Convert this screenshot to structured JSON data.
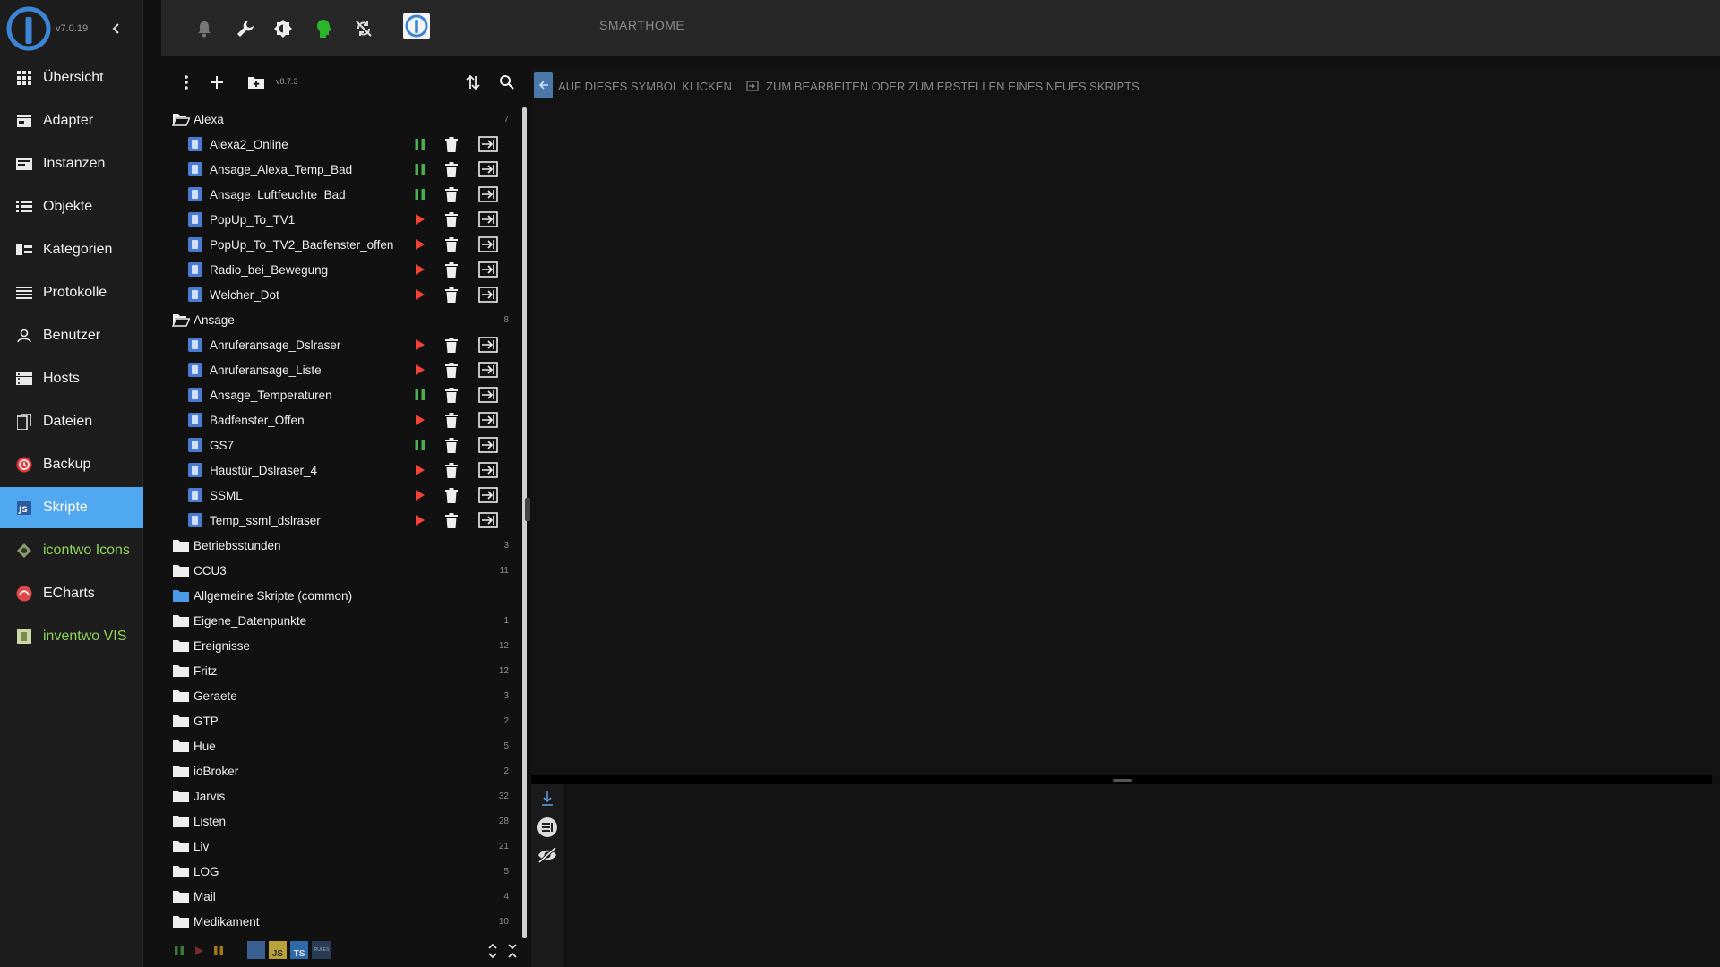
{
  "app": {
    "version": "v7.0.19",
    "brand": "SMARTHOME"
  },
  "colors": {
    "accent": "#50a8f0",
    "running": "#4caf50",
    "stopped": "#f44336",
    "instance_green": "#8fd35a"
  },
  "sidebar": {
    "items": [
      {
        "label": "Übersicht",
        "icon": "grid-icon"
      },
      {
        "label": "Adapter",
        "icon": "store-icon"
      },
      {
        "label": "Instanzen",
        "icon": "instances-icon"
      },
      {
        "label": "Objekte",
        "icon": "list-icon"
      },
      {
        "label": "Kategorien",
        "icon": "categories-icon"
      },
      {
        "label": "Protokolle",
        "icon": "lines-icon"
      },
      {
        "label": "Benutzer",
        "icon": "user-icon"
      },
      {
        "label": "Hosts",
        "icon": "hosts-icon"
      },
      {
        "label": "Dateien",
        "icon": "files-icon"
      },
      {
        "label": "Backup",
        "icon": "backup-icon"
      },
      {
        "label": "Skripte",
        "icon": "js-icon"
      },
      {
        "label": "icontwo Icons",
        "icon": "icontwo-icon"
      },
      {
        "label": "ECharts",
        "icon": "echarts-icon"
      },
      {
        "label": "inventwo VIS",
        "icon": "inventwo-icon"
      }
    ]
  },
  "tree": {
    "version": "v8.7.3",
    "groups": [
      {
        "name": "Alexa",
        "count": "7",
        "scripts": [
          {
            "name": "Alexa2_Online",
            "state": "running"
          },
          {
            "name": "Ansage_Alexa_Temp_Bad",
            "state": "running"
          },
          {
            "name": "Ansage_Luftfeuchte_Bad",
            "state": "running"
          },
          {
            "name": "PopUp_To_TV1",
            "state": "stopped"
          },
          {
            "name": "PopUp_To_TV2_Badfenster_offen",
            "state": "stopped"
          },
          {
            "name": "Radio_bei_Bewegung",
            "state": "stopped"
          },
          {
            "name": "Welcher_Dot",
            "state": "stopped"
          }
        ]
      },
      {
        "name": "Ansage",
        "count": "8",
        "scripts": [
          {
            "name": "Anruferansage_Dslraser",
            "state": "stopped"
          },
          {
            "name": "Anruferansage_Liste",
            "state": "stopped"
          },
          {
            "name": "Ansage_Temperaturen",
            "state": "running"
          },
          {
            "name": "Badfenster_Offen",
            "state": "stopped"
          },
          {
            "name": "GS7",
            "state": "running"
          },
          {
            "name": "Haustür_Dslraser_4",
            "state": "stopped"
          },
          {
            "name": "SSML",
            "state": "stopped"
          },
          {
            "name": "Temp_ssml_dslraser",
            "state": "stopped"
          }
        ]
      }
    ],
    "folders": [
      {
        "name": "Betriebsstunden",
        "count": "3"
      },
      {
        "name": "CCU3",
        "count": "11"
      },
      {
        "name": "Allgemeine Skripte (common)",
        "count": ""
      },
      {
        "name": "Eigene_Datenpunkte",
        "count": "1"
      },
      {
        "name": "Ereignisse",
        "count": "12"
      },
      {
        "name": "Fritz",
        "count": "12"
      },
      {
        "name": "Geraete",
        "count": "3"
      },
      {
        "name": "GTP",
        "count": "2"
      },
      {
        "name": "Hue",
        "count": "5"
      },
      {
        "name": "ioBroker",
        "count": "2"
      },
      {
        "name": "Jarvis",
        "count": "32"
      },
      {
        "name": "Listen",
        "count": "28"
      },
      {
        "name": "Liv",
        "count": "21"
      },
      {
        "name": "LOG",
        "count": "5"
      },
      {
        "name": "Mail",
        "count": "4"
      },
      {
        "name": "Medikament",
        "count": "10"
      }
    ],
    "bottom_badges": [
      "JS",
      "TS",
      "RULES"
    ]
  },
  "editor": {
    "hint_click": "AUF DIESES SYMBOL KLICKEN",
    "hint_create": "ZUM BEARBEITEN ODER ZUM ERSTELLEN EINES NEUES SKRIPTS"
  }
}
